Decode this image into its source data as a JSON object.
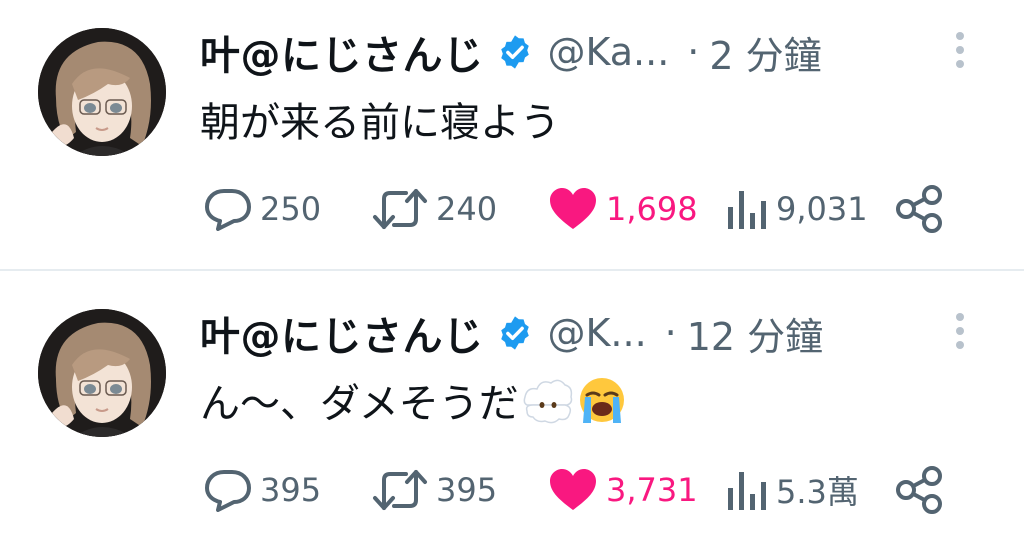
{
  "tweets": [
    {
      "name": "叶@にじさんじ",
      "handle": "@Ka...",
      "separator": "·",
      "time": "2 分鐘",
      "text": "朝が来る前に寝よう",
      "emojis": [],
      "replies": "250",
      "retweets": "240",
      "likes": "1,698",
      "views": "9,031",
      "liked": true
    },
    {
      "name": "叶@にじさんじ",
      "handle": "@K...",
      "separator": "·",
      "time": "12 分鐘",
      "text": "ん～、ダメそうだ",
      "emojis": [
        "face-in-clouds-emoji",
        "loudly-crying-face-emoji"
      ],
      "replies": "395",
      "retweets": "395",
      "likes": "3,731",
      "views": "5.3萬",
      "liked": true
    }
  ],
  "colors": {
    "verified": "#1d9bf0",
    "like": "#f91880",
    "muted": "#536471",
    "text": "#0f1419"
  }
}
